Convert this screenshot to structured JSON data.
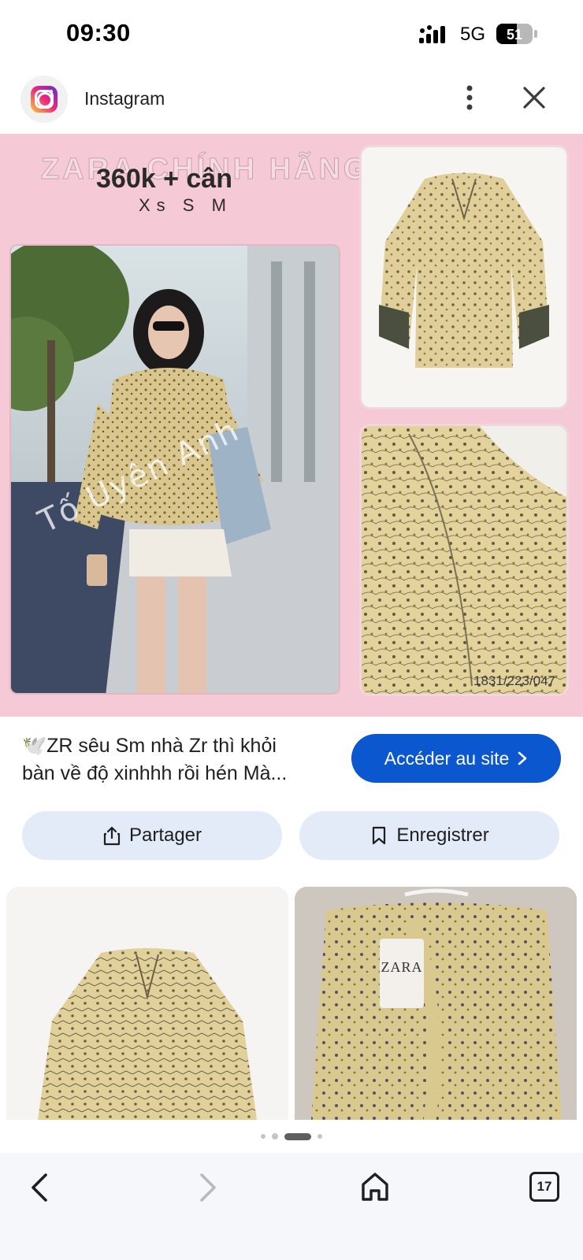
{
  "status_bar": {
    "time": "09:30",
    "network": "5G",
    "battery": "51"
  },
  "header": {
    "source": "Instagram",
    "icons": [
      "instagram-logo-icon",
      "more-vert-icon",
      "close-icon"
    ]
  },
  "main_image": {
    "brand_text": "ZARA CHÍNH HÃNG",
    "price": "360k + cân",
    "sizes": "Xs S M",
    "watermark": "Tố Uyên Anh",
    "product_code": "1831/223/047",
    "background_color": "#f6c9d6"
  },
  "description": {
    "line1": "🕊️ZR sêu Sm nhà Zr thì khỏi",
    "line2": "bàn về độ xinhhh rồi hén Mà..."
  },
  "actions": {
    "visit_label": "Accéder au site",
    "share_label": "Partager",
    "save_label": "Enregistrer",
    "accent_color": "#0b57d0"
  },
  "related": {
    "tag_text": "ZARA"
  },
  "pager": {
    "count": 4,
    "active_index": 2
  },
  "bottom_nav": {
    "tab_count": "17"
  }
}
